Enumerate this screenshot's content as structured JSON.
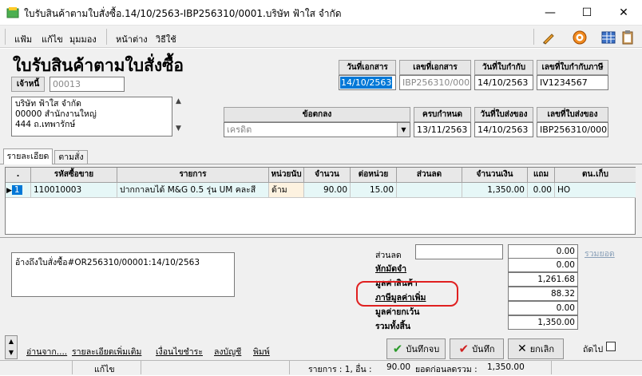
{
  "window": {
    "title": "ใบรับสินค้าตามใบสั่งซื้อ.14/10/2563-IBP256310/0001.บริษัท ฟ้าใส จำกัด",
    "minimize": "—",
    "maximize": "☐",
    "close": "✕"
  },
  "menu": [
    "แฟ้ม",
    "แก้ไข",
    "มุมมอง",
    "หน้าต่าง",
    "วิธีใช้"
  ],
  "doc_title": "ใบรับสินค้าตามใบสั่งซื้อ",
  "creditor": {
    "label": "เจ้าหนี้",
    "code": "00013"
  },
  "address": [
    "บริษัท ฟ้าใส จำกัด",
    "00000 สำนักงานใหญ่",
    "444 ถ.เทพารักษ์"
  ],
  "header_fields": {
    "doc_date_label": "วันที่เอกสาร",
    "doc_date": "14/10/2563",
    "doc_no_label": "เลขที่เอกสาร",
    "doc_no": "IBP256310/0001",
    "tax_inv_date_label": "วันที่ใบกำกับ",
    "tax_inv_date": "14/10/2563",
    "tax_inv_no_label": "เลขที่ใบกำกับภาษี",
    "tax_inv_no": "IV1234567",
    "terms_label": "ข้อตกลง",
    "terms": "เครดิต",
    "due_label": "ครบกำหนด",
    "due": "13/11/2563",
    "delivery_date_label": "วันที่ใบส่งของ",
    "delivery_date": "14/10/2563",
    "delivery_no_label": "เลขที่ใบส่งของ",
    "delivery_no": "IBP256310/0001"
  },
  "tabs": [
    "รายละเอียด",
    "ตามสั่ง"
  ],
  "grid": {
    "columns": [
      ".",
      "รหัสซื้อขาย",
      "รายการ",
      "หน่วยนับ",
      "จำนวน",
      "ต่อหน่วย",
      "ส่วนลด",
      "จำนวนเงิน",
      "แถม",
      "ตน.เก็บ"
    ],
    "rows": [
      {
        "no": "1",
        "code": "110010003",
        "desc": "ปากกาลบได้ M&G 0.5 รุ่น UM คละสี",
        "unit": "ด้าม",
        "qty": "90.00",
        "price": "15.00",
        "discount": "",
        "amount": "1,350.00",
        "free": "0.00",
        "loc": "HO"
      }
    ]
  },
  "reference": "อ้างถึงใบสั่งซื้อ#OR256310/00001:14/10/2563",
  "summary": {
    "discount_label": "ส่วนลด",
    "discount_value": "0.00",
    "total_discount_link": "รวมยอด",
    "deposit_label": "หักมัดจำ",
    "deposit": "0.00",
    "goods_value_label": "มูลค่าสินค้า",
    "goods_value": "1,261.68",
    "vat_label": "ภาษีมูลค่าเพิ่ม",
    "vat": "88.32",
    "exempt_label": "มูลค่ายกเว้น",
    "exempt": "0.00",
    "grand_total_label": "รวมทั้งสิ้น",
    "grand_total": "1,350.00"
  },
  "footer_links": [
    "อ่านจาก....",
    "รายละเอียดเพิ่มเติม",
    "เงื่อนไขชำระ",
    "ลงบัญชี",
    "พิมพ์"
  ],
  "buttons": {
    "save_print": "บันทึกจบ",
    "save": "บันทึก",
    "cancel": "ยกเลิก"
  },
  "next_label": "ถัดไป",
  "status": {
    "mode": "แก้ไข",
    "items": "รายการ : 1, อื่น :",
    "amount": "90.00",
    "before_discount_label": "ยอดก่อนลดรวม :",
    "before_discount": "1,350.00"
  },
  "colors": {
    "selection": "#0078d7",
    "highlight": "#e02020",
    "row_bg": "#e6f7f7"
  }
}
